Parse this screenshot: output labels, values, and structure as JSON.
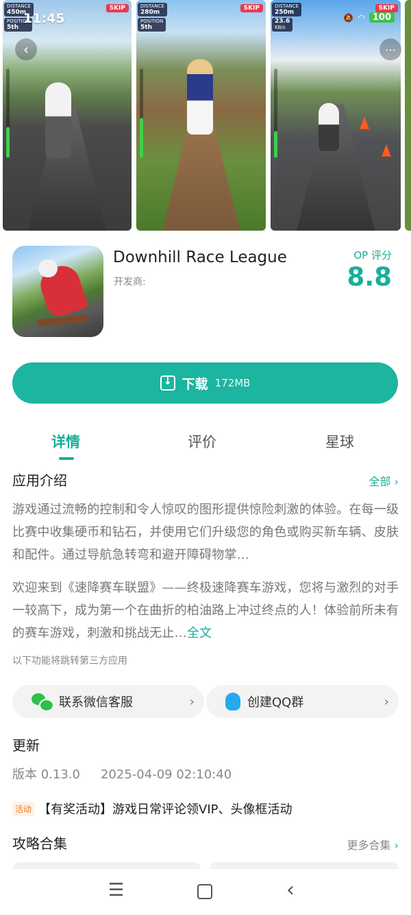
{
  "status_bar": {
    "time": "11:45",
    "battery": "100"
  },
  "screenshots": [
    {
      "hud_distance_label": "DISTANCE",
      "hud_distance": "450m",
      "hud_position_label": "POSITION",
      "hud_position": "5th",
      "skip": "SKIP"
    },
    {
      "hud_distance_label": "DISTANCE",
      "hud_distance": "280m",
      "hud_position_label": "POSITION",
      "hud_position": "5th",
      "skip": "SKIP"
    },
    {
      "hud_distance_label": "DISTANCE",
      "hud_distance": "250m",
      "hud_extra": "23.6",
      "hud_extra2": "KB/s",
      "skip": "SKIP"
    }
  ],
  "app": {
    "title": "Downhill Race League",
    "developer_label": "开发商:",
    "rating_label": "OP 评分",
    "rating": "8.8"
  },
  "download": {
    "label": "下载",
    "size": "172MB"
  },
  "tabs": [
    {
      "label": "详情"
    },
    {
      "label": "评价"
    },
    {
      "label": "星球"
    }
  ],
  "intro": {
    "title": "应用介绍",
    "more": "全部",
    "para1": "游戏通过流畅的控制和令人惊叹的图形提供惊险刺激的体验。在每一级比赛中收集硬币和钻石，并使用它们升级您的角色或购买新车辆、皮肤和配件。通过导航急转弯和避开障碍物掌…",
    "para2": "欢迎来到《速降赛车联盟》——终极速降赛车游戏，您将与激烈的对手一较高下，成为第一个在曲折的柏油路上冲过终点的人！体验前所未有的赛车游戏，刺激和挑战无止…",
    "para2_full": "全文",
    "third_party_note": "以下功能将跳转第三方应用"
  },
  "actions": {
    "wechat": "联系微信客服",
    "qq": "创建QQ群"
  },
  "update": {
    "title": "更新",
    "version": "版本 0.13.0",
    "date": "2025-04-09 02:10:40",
    "promo_tag": "活动",
    "promo_text": "【有奖活动】游戏日常评论领VIP、头像框活动"
  },
  "guides": {
    "title": "攻略合集",
    "more": "更多合集"
  },
  "colors": {
    "accent": "#1aae9a",
    "button": "#1cb59f",
    "promo": "#f07a28"
  },
  "icons": [
    "back-icon",
    "more-icon",
    "download-icon",
    "chevron-right-icon",
    "wechat-icon",
    "qq-icon",
    "menu-icon",
    "home-icon",
    "nav-back-icon"
  ]
}
